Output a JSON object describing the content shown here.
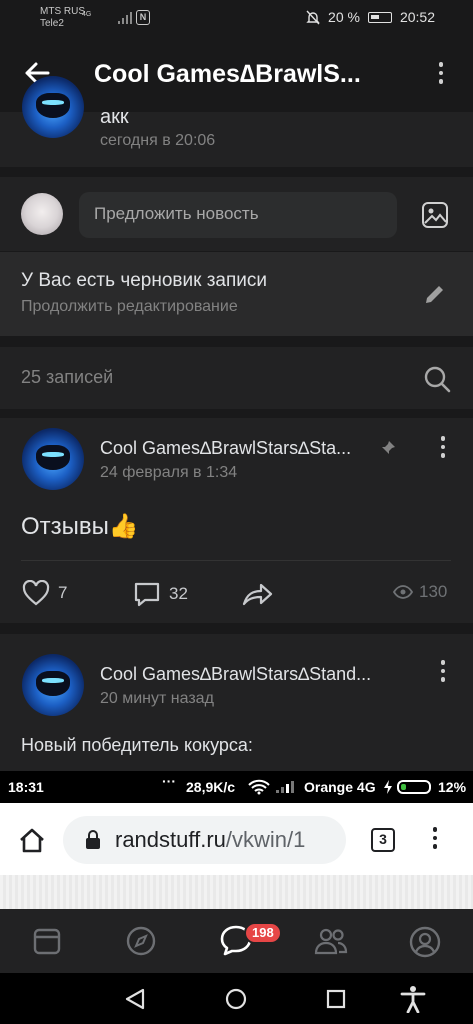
{
  "status_bar": {
    "carrier1": "MTS RUS",
    "carrier2": "Tele2",
    "network": "4G",
    "battery": "20 %",
    "time": "20:52"
  },
  "header": {
    "title": "Cool Games∆BrawlS..."
  },
  "previous_post": {
    "text": "акк",
    "time": "сегодня в 20:06"
  },
  "suggest": {
    "placeholder": "Предложить новость"
  },
  "draft": {
    "title": "У Вас есть черновик записи",
    "subtitle": "Продолжить редактирование"
  },
  "posts_header": {
    "count_label": "25 записей"
  },
  "posts": [
    {
      "author": "Cool Games∆BrawlStars∆Sta...",
      "time": "24 февраля в 1:34",
      "text": "Отзывы",
      "emoji": "👍",
      "likes": "7",
      "comments": "32",
      "views": "130",
      "pinned": true
    },
    {
      "author": "Cool Games∆BrawlStars∆Stand...",
      "time": "20 минут назад",
      "text": "Новый победитель кокурса:"
    }
  ],
  "chrome_status": {
    "time": "18:31",
    "speed": "28,9K/c",
    "carrier": "Orange 4G",
    "battery": "12%"
  },
  "browser": {
    "url_domain": "randstuff.ru",
    "url_path": "/vkwin/1",
    "tab_count": "3"
  },
  "tabbar": {
    "messages_badge": "198"
  },
  "colors": {
    "background": "#19191a",
    "card": "#222223",
    "badge": "#e64646",
    "secondary_text": "#828282"
  }
}
